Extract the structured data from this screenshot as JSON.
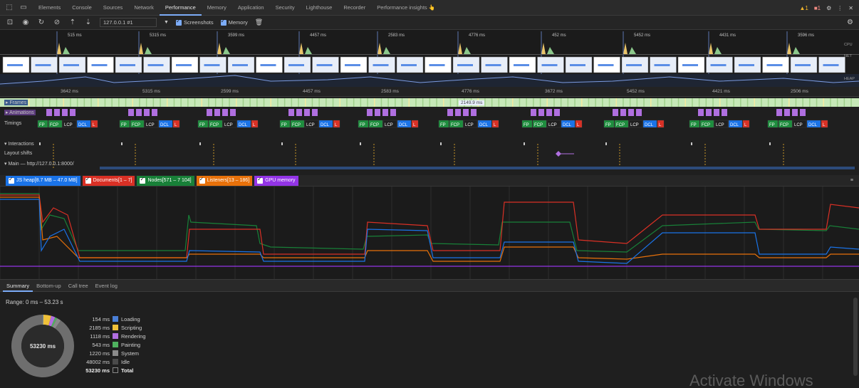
{
  "tabbar": {
    "tabs": [
      {
        "label": "Elements",
        "active": false
      },
      {
        "label": "Console",
        "active": false
      },
      {
        "label": "Sources",
        "active": false
      },
      {
        "label": "Network",
        "active": false
      },
      {
        "label": "Performance",
        "active": true
      },
      {
        "label": "Memory",
        "active": false
      },
      {
        "label": "Application",
        "active": false
      },
      {
        "label": "Security",
        "active": false
      },
      {
        "label": "Lighthouse",
        "active": false
      },
      {
        "label": "Recorder",
        "active": false
      },
      {
        "label": "Performance insights 👆",
        "active": false
      }
    ],
    "warn_count": "1",
    "error_count": "1"
  },
  "toolbar": {
    "recording_select": "127.0.0.1 #1",
    "screenshots_label": "Screenshots",
    "memory_label": "Memory"
  },
  "overview": {
    "durations": [
      "515 ms",
      "5315 ms",
      "3599 ms",
      "4457 ms",
      "2583 ms",
      "4776 ms",
      "452 ms",
      "5452 ms",
      "4431 ms",
      "3596 ms"
    ],
    "cpu_label": "CPU",
    "net_label": "NET",
    "heap_label": "HEAP"
  },
  "ruler": {
    "ticks": [
      "3642 ms",
      "5315 ms",
      "2599 ms",
      "4457 ms",
      "2583 ms",
      "4776 ms",
      "3672 ms",
      "5452 ms",
      "4421 ms",
      "2506 ms"
    ]
  },
  "tracks": {
    "frames_label": "Frames",
    "frames_duration": "2149.9 ms",
    "animations_label": "Animations",
    "timings_label": "Timings",
    "interactions_label": "Interactions",
    "layout_shifts_label": "Layout shifts",
    "main_label": "Main — http://127.0.0.1:8000/",
    "timing_markers": [
      "FP",
      "FCP",
      "LCP",
      "DCL",
      "L"
    ]
  },
  "memory_legend": [
    {
      "label": "JS heap[8.7 MB – 47.0 MB]",
      "color": "#1a73e8"
    },
    {
      "label": "Documents[1 – 7]",
      "color": "#d93025"
    },
    {
      "label": "Nodes[571 – 7 104]",
      "color": "#188038"
    },
    {
      "label": "Listeners[13 – 186]",
      "color": "#e8710a"
    },
    {
      "label": "GPU memory",
      "color": "#9334e6"
    }
  ],
  "bottom_tabs": [
    {
      "label": "Summary",
      "active": true
    },
    {
      "label": "Bottom-up",
      "active": false
    },
    {
      "label": "Call tree",
      "active": false
    },
    {
      "label": "Event log",
      "active": false
    }
  ],
  "summary": {
    "range": "Range: 0 ms – 53.23 s",
    "donut_center": "53230 ms",
    "rows": [
      {
        "value": "154 ms",
        "label": "Loading",
        "color": "#4a7fd6",
        "ms": 154
      },
      {
        "value": "2185 ms",
        "label": "Scripting",
        "color": "#f0c13a",
        "ms": 2185
      },
      {
        "value": "1118 ms",
        "label": "Rendering",
        "color": "#b16fe0",
        "ms": 1118
      },
      {
        "value": "543 ms",
        "label": "Painting",
        "color": "#4fb25f",
        "ms": 543
      },
      {
        "value": "1220 ms",
        "label": "System",
        "color": "#8a8a8a",
        "ms": 1220
      },
      {
        "value": "48002 ms",
        "label": "Idle",
        "color": "#4a4a4a",
        "ms": 48002
      }
    ],
    "total": {
      "value": "53230 ms",
      "label": "Total"
    }
  },
  "watermark": "Activate Windows"
}
